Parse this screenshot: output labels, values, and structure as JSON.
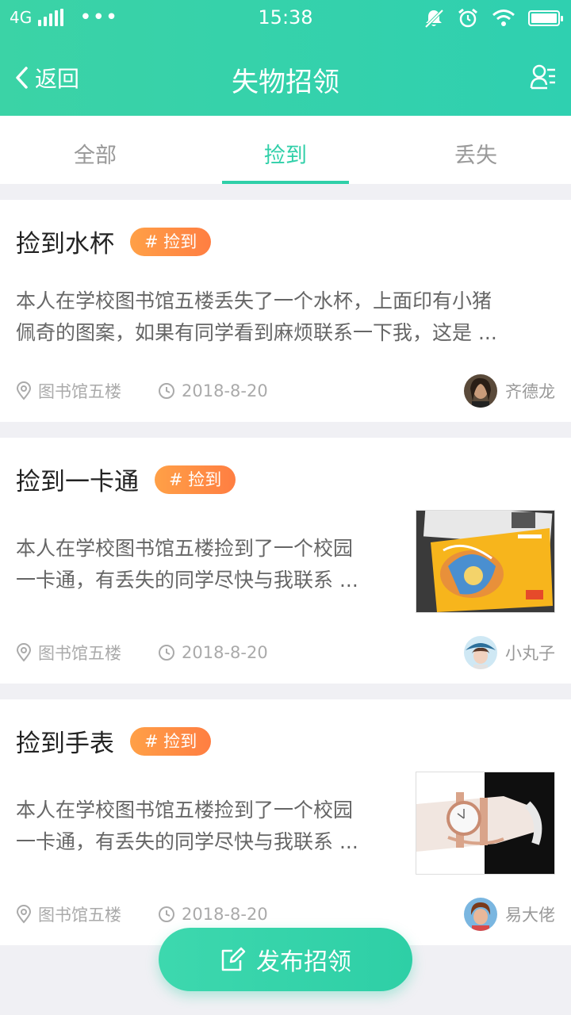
{
  "status_bar": {
    "network": "4G",
    "dots": "•••",
    "time": "15:38"
  },
  "nav": {
    "back_label": "返回",
    "title": "失物招领"
  },
  "tabs": [
    {
      "label": "全部",
      "active": false
    },
    {
      "label": "捡到",
      "active": true
    },
    {
      "label": "丢失",
      "active": false
    }
  ],
  "posts": [
    {
      "title": "捡到水杯",
      "tag": "# 捡到",
      "desc_line1": "本人在学校图书馆五楼丢失了一个水杯，上面印有小猪",
      "desc_line2": "佩奇的图案，如果有同学看到麻烦联系一下我，这是 ...",
      "location": "图书馆五楼",
      "date": "2018-8-20",
      "author": "齐德龙"
    },
    {
      "title": "捡到一卡通",
      "tag": "# 捡到",
      "desc_line1": "本人在学校图书馆五楼捡到了一个校园",
      "desc_line2": "一卡通，有丢失的同学尽快与我联系 ...",
      "location": "图书馆五楼",
      "date": "2018-8-20",
      "author": "小丸子"
    },
    {
      "title": "捡到手表",
      "tag": "# 捡到",
      "desc_line1": "本人在学校图书馆五楼捡到了一个校园",
      "desc_line2": "一卡通，有丢失的同学尽快与我联系 ...",
      "location": "图书馆五楼",
      "date": "2018-8-20",
      "author": "易大佬"
    }
  ],
  "fab": {
    "label": "发布招领"
  },
  "colors": {
    "primary": "#2fcfa8",
    "badge": "#ff8a45",
    "background": "#f0f0f4"
  }
}
